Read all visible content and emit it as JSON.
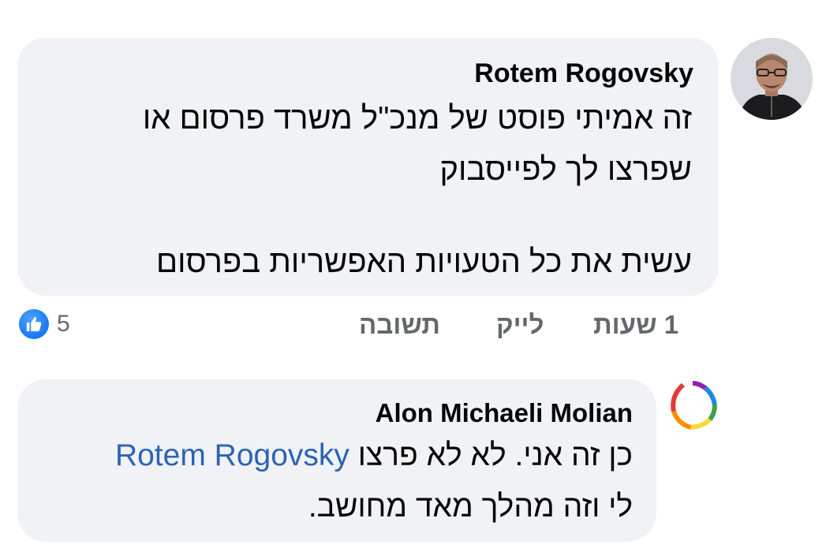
{
  "comments": [
    {
      "author": "Rotem Rogovsky",
      "lines": [
        "זה אמיתי פוסט של מנכ\"ל משרד פרסום או",
        "שפרצו לך לפייסבוק",
        "עשית את כל הטעויות האפשריות בפרסום"
      ],
      "actions": {
        "time": "1 שעות",
        "like": "לייק",
        "reply": "תשובה"
      },
      "reaction_count": "5",
      "reaction_icon": "thumbs-up-icon",
      "colors": {
        "reaction": "#1877f2"
      }
    },
    {
      "author": "Alon Michaeli Molian",
      "mention": "Rotem Rogovsky",
      "line1_text": "כן זה אני. לא לא פרצו",
      "line2": "לי וזה מהלך מאד מחושב."
    }
  ],
  "colors": {
    "bubble": "#f0f2f5",
    "meta": "#65676b",
    "mention": "#2b63b5"
  }
}
